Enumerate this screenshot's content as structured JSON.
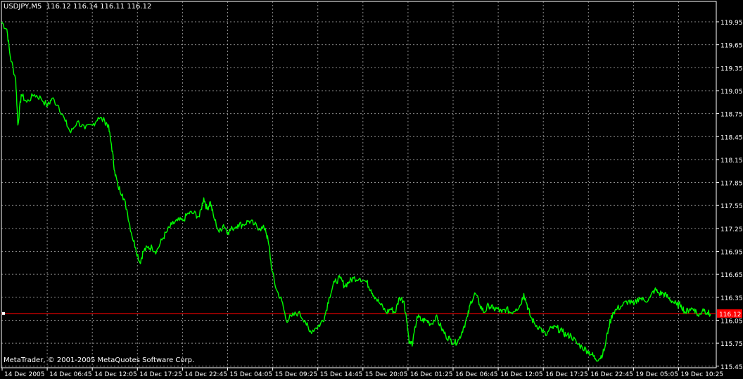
{
  "header": {
    "symbol": "USDJPY,M5",
    "open": "116.12",
    "high": "116.14",
    "low": "116.11",
    "close": "116.12"
  },
  "copyright": "MetaTrader, © 2001-2005 MetaQuotes Software Corp.",
  "current_price_label": "116.12",
  "colors": {
    "background": "#000000",
    "grid": "#c8c8c8",
    "price_line": "#00ff00",
    "bid_line": "#ff0000",
    "text": "#ffffff",
    "bid_label_bg": "#ff0000"
  },
  "chart_data": {
    "type": "line",
    "title": "",
    "xlabel": "",
    "ylabel": "",
    "ylim": [
      115.35,
      120.05
    ],
    "y_ticks": [
      "119.95",
      "119.65",
      "119.35",
      "119.05",
      "118.75",
      "118.45",
      "118.15",
      "117.85",
      "117.55",
      "117.25",
      "116.95",
      "116.65",
      "116.35",
      "116.05",
      "115.75",
      "115.45"
    ],
    "x_ticks": [
      "14 Dec 2005",
      "14 Dec 06:45",
      "14 Dec 12:05",
      "14 Dec 17:25",
      "14 Dec 22:45",
      "15 Dec 04:05",
      "15 Dec 09:25",
      "15 Dec 14:45",
      "15 Dec 20:05",
      "16 Dec 01:25",
      "16 Dec 06:45",
      "16 Dec 12:05",
      "16 Dec 17:25",
      "16 Dec 22:45",
      "19 Dec 05:05",
      "19 Dec 10:25"
    ],
    "grid": true,
    "current_price": 116.12,
    "series": [
      {
        "values": [
          [
            0,
            119.95
          ],
          [
            0.5,
            119.85
          ],
          [
            0.8,
            119.5
          ],
          [
            1.3,
            119.2
          ],
          [
            1.5,
            118.6
          ],
          [
            1.8,
            119.0
          ],
          [
            2.3,
            118.9
          ],
          [
            3.0,
            119.0
          ],
          [
            3.6,
            118.95
          ],
          [
            4.2,
            118.85
          ],
          [
            4.6,
            118.95
          ],
          [
            5.2,
            118.85
          ],
          [
            5.8,
            118.65
          ],
          [
            6.3,
            118.5
          ],
          [
            6.9,
            118.65
          ],
          [
            7.6,
            118.55
          ],
          [
            8.3,
            118.6
          ],
          [
            8.8,
            118.7
          ],
          [
            9.4,
            118.65
          ],
          [
            9.7,
            118.6
          ],
          [
            10.0,
            118.35
          ],
          [
            10.3,
            118.0
          ],
          [
            10.6,
            117.8
          ],
          [
            11.0,
            117.7
          ],
          [
            11.4,
            117.5
          ],
          [
            11.8,
            117.2
          ],
          [
            12.2,
            117.0
          ],
          [
            12.6,
            116.8
          ],
          [
            12.9,
            116.95
          ],
          [
            13.3,
            117.0
          ],
          [
            13.7,
            117.0
          ],
          [
            14.1,
            116.95
          ],
          [
            14.6,
            117.1
          ],
          [
            15.0,
            117.2
          ],
          [
            15.5,
            117.3
          ],
          [
            16.0,
            117.35
          ],
          [
            16.5,
            117.35
          ],
          [
            17.0,
            117.45
          ],
          [
            17.5,
            117.45
          ],
          [
            18.0,
            117.4
          ],
          [
            18.4,
            117.65
          ],
          [
            18.7,
            117.5
          ],
          [
            19.0,
            117.6
          ],
          [
            19.3,
            117.4
          ],
          [
            19.8,
            117.2
          ],
          [
            20.2,
            117.3
          ],
          [
            20.6,
            117.2
          ],
          [
            21.0,
            117.25
          ],
          [
            21.5,
            117.3
          ],
          [
            22.0,
            117.3
          ],
          [
            22.5,
            117.35
          ],
          [
            23.0,
            117.3
          ],
          [
            23.5,
            117.25
          ],
          [
            24.0,
            117.25
          ],
          [
            24.3,
            117.05
          ],
          [
            24.6,
            116.7
          ],
          [
            25.0,
            116.45
          ],
          [
            25.5,
            116.3
          ],
          [
            25.9,
            116.05
          ],
          [
            26.4,
            116.1
          ],
          [
            27.0,
            116.15
          ],
          [
            27.6,
            116.05
          ],
          [
            28.0,
            115.9
          ],
          [
            28.6,
            115.95
          ],
          [
            29.0,
            116.0
          ],
          [
            29.4,
            116.1
          ],
          [
            29.8,
            116.35
          ],
          [
            30.3,
            116.55
          ],
          [
            30.8,
            116.6
          ],
          [
            31.2,
            116.5
          ],
          [
            31.6,
            116.55
          ],
          [
            32.0,
            116.6
          ],
          [
            32.6,
            116.6
          ],
          [
            33.2,
            116.55
          ],
          [
            33.6,
            116.45
          ],
          [
            34.0,
            116.35
          ],
          [
            34.5,
            116.25
          ],
          [
            35.0,
            116.15
          ],
          [
            35.4,
            116.2
          ],
          [
            35.8,
            116.15
          ],
          [
            36.2,
            116.35
          ],
          [
            36.6,
            116.3
          ],
          [
            36.9,
            116.0
          ],
          [
            37.1,
            115.75
          ],
          [
            37.4,
            115.75
          ],
          [
            37.8,
            116.1
          ],
          [
            38.2,
            116.05
          ],
          [
            38.6,
            116.05
          ],
          [
            39.1,
            116.0
          ],
          [
            39.5,
            116.1
          ],
          [
            40.0,
            115.95
          ],
          [
            40.4,
            115.85
          ],
          [
            40.8,
            115.8
          ],
          [
            41.2,
            115.75
          ],
          [
            41.6,
            115.8
          ],
          [
            42.0,
            115.95
          ],
          [
            42.4,
            116.1
          ],
          [
            42.7,
            116.3
          ],
          [
            43.1,
            116.4
          ],
          [
            43.5,
            116.25
          ],
          [
            43.9,
            116.15
          ],
          [
            44.3,
            116.25
          ],
          [
            44.7,
            116.2
          ],
          [
            45.1,
            116.2
          ],
          [
            45.5,
            116.15
          ],
          [
            45.9,
            116.2
          ],
          [
            46.3,
            116.15
          ],
          [
            46.8,
            116.2
          ],
          [
            47.2,
            116.25
          ],
          [
            47.5,
            116.4
          ],
          [
            47.8,
            116.25
          ],
          [
            48.1,
            116.1
          ],
          [
            48.5,
            116.0
          ],
          [
            49.0,
            115.95
          ],
          [
            49.5,
            115.85
          ],
          [
            50.0,
            115.95
          ],
          [
            50.5,
            115.95
          ],
          [
            51.0,
            115.9
          ],
          [
            51.4,
            115.85
          ],
          [
            51.8,
            115.85
          ],
          [
            52.3,
            115.75
          ],
          [
            52.8,
            115.7
          ],
          [
            53.3,
            115.65
          ],
          [
            53.7,
            115.6
          ],
          [
            54.0,
            115.55
          ],
          [
            54.4,
            115.55
          ],
          [
            54.8,
            115.65
          ],
          [
            55.2,
            115.95
          ],
          [
            55.6,
            116.15
          ],
          [
            56.0,
            116.2
          ],
          [
            56.5,
            116.25
          ],
          [
            57.0,
            116.3
          ],
          [
            57.5,
            116.25
          ],
          [
            58.0,
            116.35
          ],
          [
            58.5,
            116.3
          ],
          [
            59.0,
            116.35
          ],
          [
            59.4,
            116.45
          ],
          [
            59.8,
            116.4
          ],
          [
            60.2,
            116.4
          ],
          [
            60.6,
            116.35
          ],
          [
            61.0,
            116.3
          ],
          [
            61.4,
            116.25
          ],
          [
            61.8,
            116.25
          ],
          [
            62.2,
            116.15
          ],
          [
            62.6,
            116.2
          ],
          [
            63.0,
            116.2
          ],
          [
            63.4,
            116.1
          ],
          [
            63.8,
            116.2
          ],
          [
            64.2,
            116.15
          ],
          [
            64.5,
            116.12
          ]
        ]
      }
    ]
  }
}
